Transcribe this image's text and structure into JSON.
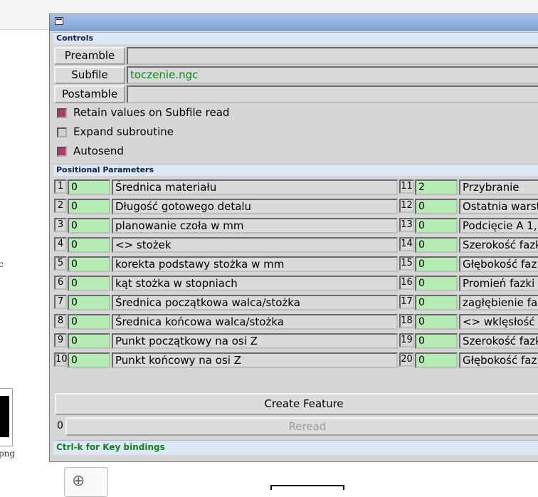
{
  "background": {
    "side_text": "c",
    "png_label": "png"
  },
  "window": {
    "controls_header": "Controls",
    "preamble_label": "Preamble",
    "preamble_value": "",
    "subfile_label": "Subfile",
    "subfile_value": "toczenie.ngc",
    "postamble_label": "Postamble",
    "postamble_value": "",
    "options": [
      {
        "label": "Retain values on Subfile read",
        "checked": true
      },
      {
        "label": "Expand subroutine",
        "checked": false
      },
      {
        "label": "Autosend",
        "checked": true
      }
    ],
    "params_header": "Positional Parameters",
    "params_left": [
      {
        "num": "1",
        "value": "0",
        "label": "Średnica materiału"
      },
      {
        "num": "2",
        "value": "0",
        "label": "Długość gotowego detalu"
      },
      {
        "num": "3",
        "value": "0",
        "label": "planowanie czoła w mm"
      },
      {
        "num": "4",
        "value": "0",
        "label": "<> stożek"
      },
      {
        "num": "5",
        "value": "0",
        "label": "korekta podstawy stożka w mm"
      },
      {
        "num": "6",
        "value": "0",
        "label": "kąt stożka w stopniach"
      },
      {
        "num": "7",
        "value": "0",
        "label": "Średnica początkowa walca/stożka"
      },
      {
        "num": "8",
        "value": "0",
        "label": "Średnica końcowa walca/stożka"
      },
      {
        "num": "9",
        "value": "0",
        "label": "Punkt początkowy na osi Z"
      },
      {
        "num": "10",
        "value": "0",
        "label": "Punkt końcowy na osi Z"
      }
    ],
    "params_right": [
      {
        "num": "11",
        "value": "2",
        "label": "Przybranie"
      },
      {
        "num": "12",
        "value": "0",
        "label": "Ostatnia warst"
      },
      {
        "num": "13",
        "value": "0",
        "label": "Podcięcie A 1,"
      },
      {
        "num": "14",
        "value": "0",
        "label": "Szerokość fazk"
      },
      {
        "num": "15",
        "value": "0",
        "label": "Głębokość faz"
      },
      {
        "num": "16",
        "value": "0",
        "label": "Promień fazki s"
      },
      {
        "num": "17",
        "value": "0",
        "label": "zagłębienie faz"
      },
      {
        "num": "18",
        "value": "0",
        "label": "<> wklęsłość fa"
      },
      {
        "num": "19",
        "value": "0",
        "label": "Szerokość fazk"
      },
      {
        "num": "20",
        "value": "0",
        "label": "Głębokość faz"
      }
    ],
    "create_label": "Create Feature",
    "reread_count": "0",
    "reread_label": "Reread",
    "status_text": "Ctrl-k for Key bindings"
  },
  "colors": {
    "checked": "#b0376a",
    "value_field": "#b4ecb4",
    "subfile_text": "#0b8a12",
    "status_text": "#14801c",
    "header_bg": "#dde7f5"
  }
}
